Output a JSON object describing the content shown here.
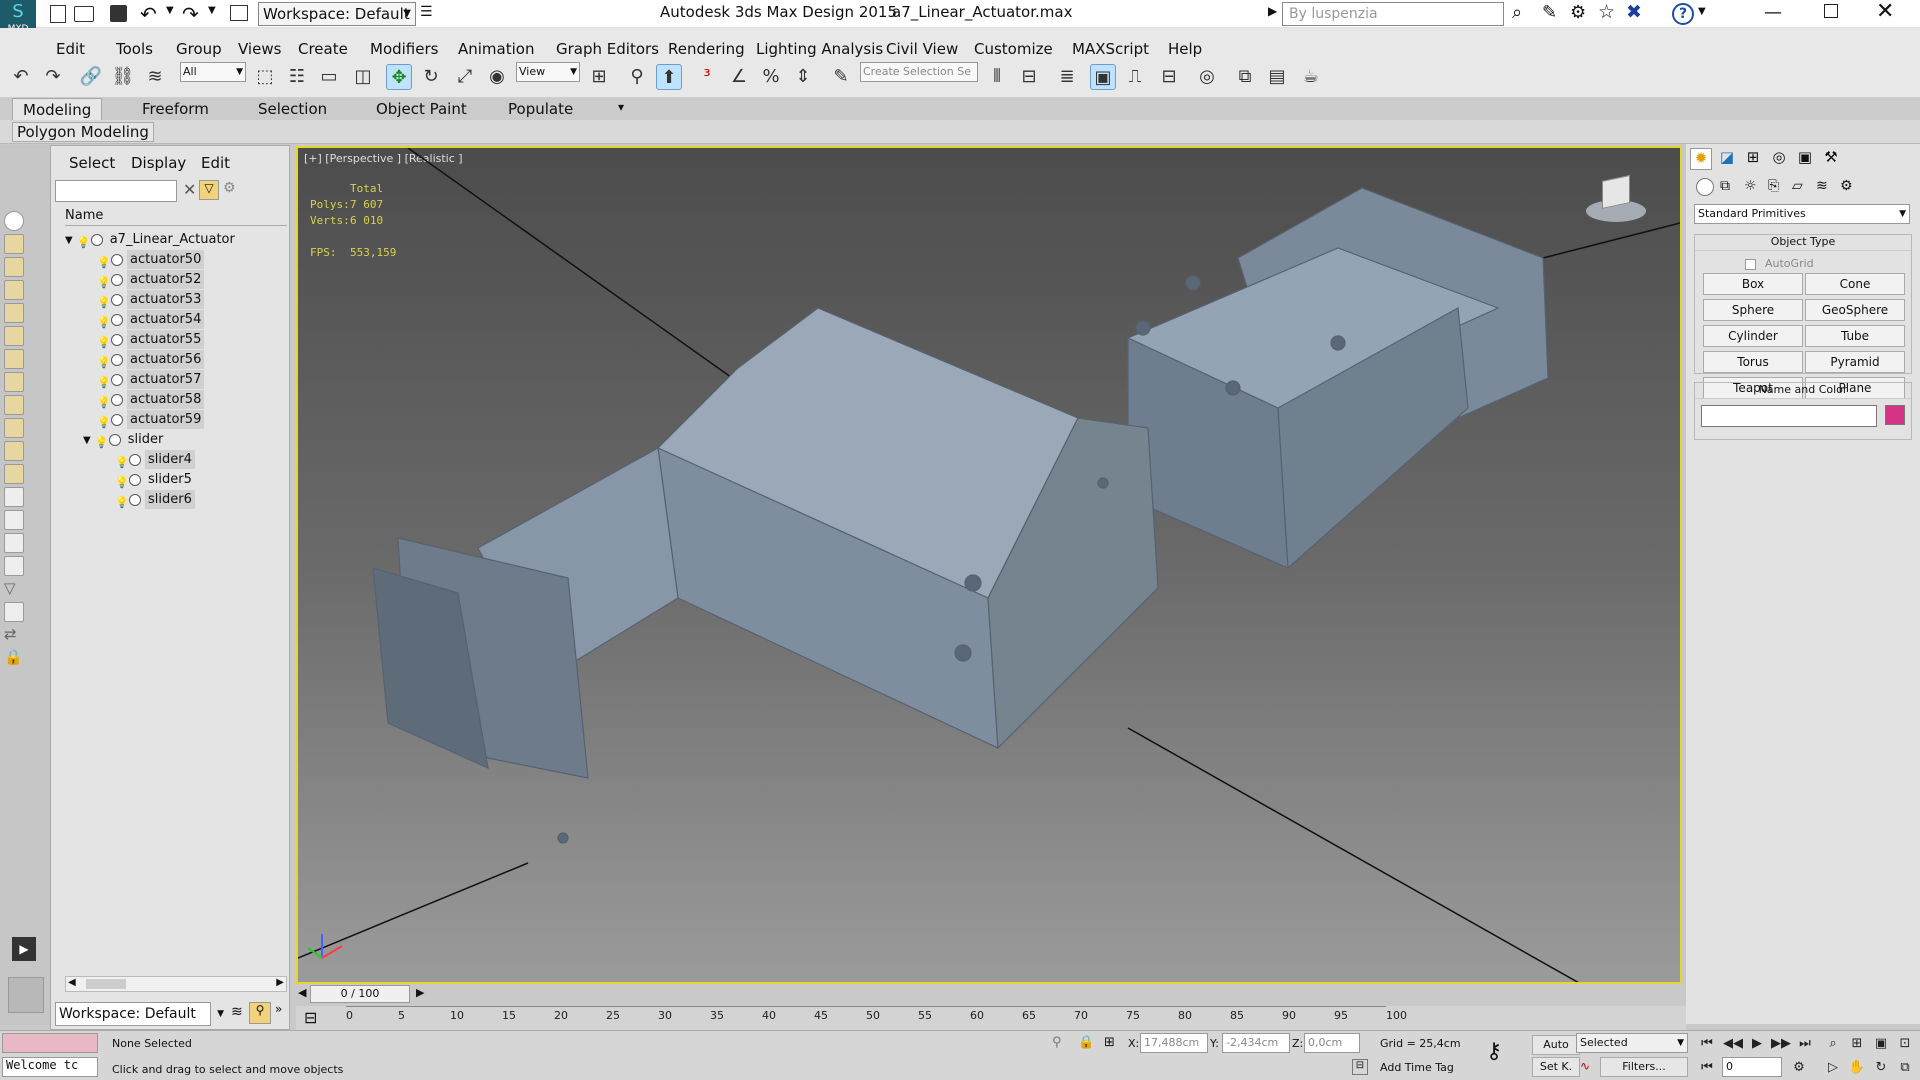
{
  "app": {
    "title": "Autodesk 3ds Max Design 2015",
    "filename": "a7_Linear_Actuator.max",
    "logo_text": "MXD",
    "workspace_label": "Workspace: Default",
    "search_placeholder": "By luspenzia"
  },
  "menu": [
    "Edit",
    "Tools",
    "Group",
    "Views",
    "Create",
    "Modifiers",
    "Animation",
    "Graph Editors",
    "Rendering",
    "Lighting Analysis",
    "Civil View",
    "Customize",
    "MAXScript",
    "Help"
  ],
  "toolbar": {
    "filter_value": "All",
    "refcoord_value": "View",
    "selection_set_placeholder": "Create Selection Se"
  },
  "ribbon": {
    "tabs": [
      "Modeling",
      "Freeform",
      "Selection",
      "Object Paint",
      "Populate"
    ],
    "active_tab": "Modeling",
    "subtab": "Polygon Modeling"
  },
  "explorer": {
    "menu": [
      "Select",
      "Display",
      "Edit"
    ],
    "column_header": "Name",
    "items": [
      {
        "label": "a7_Linear_Actuator",
        "level": 0,
        "expanded": true,
        "selected": false
      },
      {
        "label": "actuator50",
        "level": 1,
        "selected": true
      },
      {
        "label": "actuator52",
        "level": 1,
        "selected": true
      },
      {
        "label": "actuator53",
        "level": 1,
        "selected": true
      },
      {
        "label": "actuator54",
        "level": 1,
        "selected": true
      },
      {
        "label": "actuator55",
        "level": 1,
        "selected": true
      },
      {
        "label": "actuator56",
        "level": 1,
        "selected": true
      },
      {
        "label": "actuator57",
        "level": 1,
        "selected": true
      },
      {
        "label": "actuator58",
        "level": 1,
        "selected": true
      },
      {
        "label": "actuator59",
        "level": 1,
        "selected": true
      },
      {
        "label": "slider",
        "level": 1,
        "expanded": true,
        "selected": false
      },
      {
        "label": "slider4",
        "level": 2,
        "selected": true
      },
      {
        "label": "slider5",
        "level": 2,
        "selected": false
      },
      {
        "label": "slider6",
        "level": 2,
        "selected": true
      }
    ],
    "workspace_value": "Workspace: Default"
  },
  "viewport": {
    "label": "[+] [Perspective ] [Realistic ]",
    "stats": {
      "total_label": "Total",
      "polys_label": "Polys:",
      "polys_value": "7 607",
      "verts_label": "Verts:",
      "verts_value": "6 010",
      "fps_label": "FPS:",
      "fps_value": "553,159"
    },
    "model_color": "#8a9aab",
    "highlight_color": "#e5d72a"
  },
  "command_panel": {
    "category_value": "Standard Primitives",
    "object_type_title": "Object Type",
    "autogrid_label": "AutoGrid",
    "buttons": [
      "Box",
      "Cone",
      "Sphere",
      "GeoSphere",
      "Cylinder",
      "Tube",
      "Torus",
      "Pyramid",
      "Teapot",
      "Plane"
    ],
    "name_color_title": "Name and Color",
    "name_value": "",
    "object_color": "#d63384"
  },
  "timeline": {
    "slider_text": "0 / 100",
    "ticks": [
      "0",
      "5",
      "10",
      "15",
      "20",
      "25",
      "30",
      "35",
      "40",
      "45",
      "50",
      "55",
      "60",
      "65",
      "70",
      "75",
      "80",
      "85",
      "90",
      "95",
      "100"
    ]
  },
  "status": {
    "script_text": "Welcome tc",
    "selection_text": "None Selected",
    "prompt_text": "Click and drag to select and move objects",
    "x_label": "X:",
    "x_value": "17,488cm",
    "y_label": "Y:",
    "y_value": "-2,434cm",
    "z_label": "Z:",
    "z_value": "0,0cm",
    "grid_text": "Grid = 25,4cm",
    "add_time_tag": "Add Time Tag",
    "auto_label": "Auto",
    "setkey_label": "Set K.",
    "keymode_value": "Selected",
    "filters_label": "Filters...",
    "frame_value": "0"
  }
}
